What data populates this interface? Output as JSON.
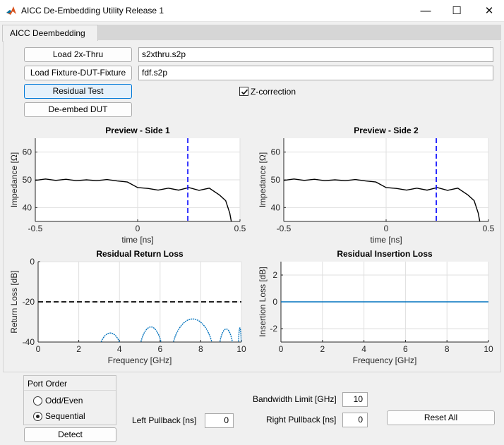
{
  "window": {
    "title": "AICC De-Embedding Utility Release 1",
    "controls": {
      "minimize": "—",
      "maximize": "☐",
      "close": "✕"
    }
  },
  "tab": {
    "label": "AICC Deembedding"
  },
  "buttons": {
    "load_2x_thru": "Load 2x-Thru",
    "load_fixture": "Load Fixture-DUT-Fixture",
    "residual_test": "Residual Test",
    "deembed_dut": "De-embed DUT",
    "detect": "Detect",
    "reset_all": "Reset All"
  },
  "fields": {
    "thru_file": "s2xthru.s2p",
    "fdf_file": "fdf.s2p"
  },
  "zcorrection": {
    "label": "Z-correction",
    "checked": true
  },
  "port_order": {
    "title": "Port Order",
    "options": [
      "Odd/Even",
      "Sequential"
    ],
    "selected": "Sequential"
  },
  "pullback": {
    "left_label": "Left Pullback [ns]",
    "left_value": "0",
    "right_label": "Right Pullback [ns]",
    "right_value": "0",
    "bandwidth_label": "Bandwidth Limit [GHz]",
    "bandwidth_value": "10"
  },
  "colors": {
    "curve_black": "#000000",
    "marker_blue": "#0000ff",
    "trace_blue": "#0072bd",
    "threshold": "#000000"
  },
  "chart_data": [
    {
      "type": "line",
      "title": "Preview - Side 1",
      "xlabel": "time [ns]",
      "ylabel": "Impedance [Ω]",
      "xlim": [
        -0.5,
        0.5
      ],
      "ylim": [
        35,
        65
      ],
      "xticks": [
        "-0.5",
        "0",
        "0.5"
      ],
      "yticks": [
        "40",
        "50",
        "60"
      ],
      "grid": true,
      "series": [
        {
          "x": [
            -0.5,
            -0.45,
            -0.4,
            -0.35,
            -0.3,
            -0.25,
            -0.2,
            -0.15,
            -0.1,
            -0.05,
            0,
            0.05,
            0.1,
            0.15,
            0.2,
            0.25,
            0.3,
            0.35,
            0.4,
            0.43,
            0.45,
            0.46
          ],
          "y": [
            49.8,
            50.3,
            49.8,
            50.2,
            49.7,
            50.0,
            49.7,
            50.1,
            49.6,
            49.2,
            47.2,
            46.9,
            46.3,
            47.0,
            46.3,
            47.2,
            46.2,
            47.0,
            44.5,
            42.5,
            38,
            34
          ]
        }
      ],
      "vline": 0.245
    },
    {
      "type": "line",
      "title": "Preview - Side 2",
      "xlabel": "time [ns]",
      "ylabel": "Impedance [Ω]",
      "xlim": [
        -0.5,
        0.5
      ],
      "ylim": [
        35,
        65
      ],
      "xticks": [
        "-0.5",
        "0",
        "0.5"
      ],
      "yticks": [
        "40",
        "50",
        "60"
      ],
      "grid": true,
      "series": [
        {
          "x": [
            -0.5,
            -0.45,
            -0.4,
            -0.35,
            -0.3,
            -0.25,
            -0.2,
            -0.15,
            -0.1,
            -0.05,
            0,
            0.05,
            0.1,
            0.15,
            0.2,
            0.25,
            0.3,
            0.35,
            0.4,
            0.43,
            0.45,
            0.46
          ],
          "y": [
            49.8,
            50.3,
            49.8,
            50.2,
            49.7,
            50.0,
            49.7,
            50.1,
            49.6,
            49.2,
            47.2,
            46.9,
            46.3,
            47.0,
            46.3,
            47.2,
            46.2,
            47.0,
            44.5,
            42.5,
            38,
            34
          ]
        }
      ],
      "vline": 0.245
    },
    {
      "type": "line",
      "title": "Residual Return Loss",
      "xlabel": "Frequency [GHz]",
      "ylabel": "Return Loss [dB]",
      "xlim": [
        0,
        10
      ],
      "ylim": [
        -40,
        0
      ],
      "xticks": [
        "0",
        "2",
        "4",
        "6",
        "8",
        "10"
      ],
      "yticks": [
        "0",
        "-20",
        "-40"
      ],
      "grid": true,
      "threshold": -20,
      "series": [
        {
          "lobes": [
            {
              "x0": 3.0,
              "x1": 4.1,
              "peak": -35.5
            },
            {
              "x0": 5.0,
              "x1": 6.1,
              "peak": -32.5
            },
            {
              "x0": 6.6,
              "x1": 8.6,
              "peak": -28.5
            },
            {
              "x0": 8.9,
              "x1": 9.6,
              "peak": -33.5
            },
            {
              "x0": 9.85,
              "x1": 10.0,
              "peak": -33
            }
          ]
        }
      ]
    },
    {
      "type": "line",
      "title": "Residual Insertion Loss",
      "xlabel": "Frequency [GHz]",
      "ylabel": "Insertion Loss [dB]",
      "xlim": [
        0,
        10
      ],
      "ylim": [
        -3,
        3
      ],
      "xticks": [
        "0",
        "2",
        "4",
        "6",
        "8",
        "10"
      ],
      "yticks": [
        "2",
        "0",
        "-2"
      ],
      "grid": true,
      "series": [
        {
          "x": [
            0,
            2,
            4,
            6,
            8,
            10
          ],
          "y": [
            0,
            0,
            0,
            0,
            0,
            0
          ]
        }
      ]
    }
  ]
}
